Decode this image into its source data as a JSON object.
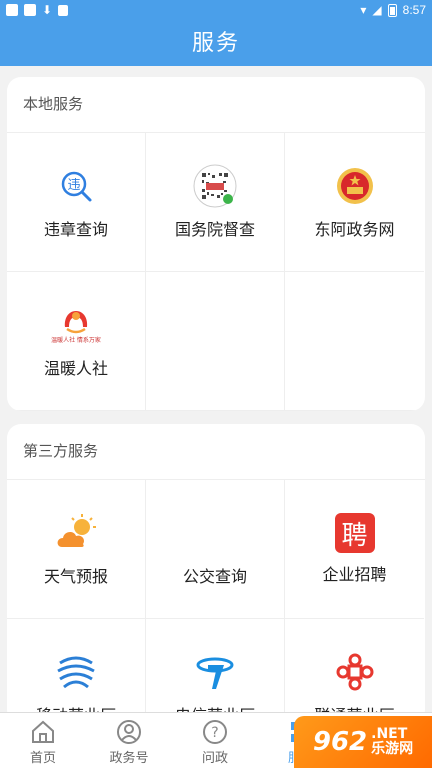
{
  "status": {
    "time": "8:57"
  },
  "header": {
    "title": "服务"
  },
  "local": {
    "title": "本地服务",
    "items": [
      {
        "label": "违章查询"
      },
      {
        "label": "国务院督查"
      },
      {
        "label": "东阿政务网"
      },
      {
        "label": "温暖人社",
        "sublabel": "温暖人社 情系万家"
      }
    ]
  },
  "third": {
    "title": "第三方服务",
    "items": [
      {
        "label": "天气预报"
      },
      {
        "label": "公交查询"
      },
      {
        "label": "企业招聘",
        "glyph": "聘"
      },
      {
        "label": "移动营业厅"
      },
      {
        "label": "电信营业厅"
      },
      {
        "label": "联通营业厅"
      }
    ]
  },
  "tabs": [
    {
      "label": "首页"
    },
    {
      "label": "政务号"
    },
    {
      "label": "问政"
    },
    {
      "label": "服务"
    }
  ],
  "watermark": {
    "num": "962",
    "net": ".NET",
    "sub": "乐游网"
  },
  "colors": {
    "primary": "#4a9fea",
    "red": "#e7382f",
    "orange": "#f7a23b"
  }
}
